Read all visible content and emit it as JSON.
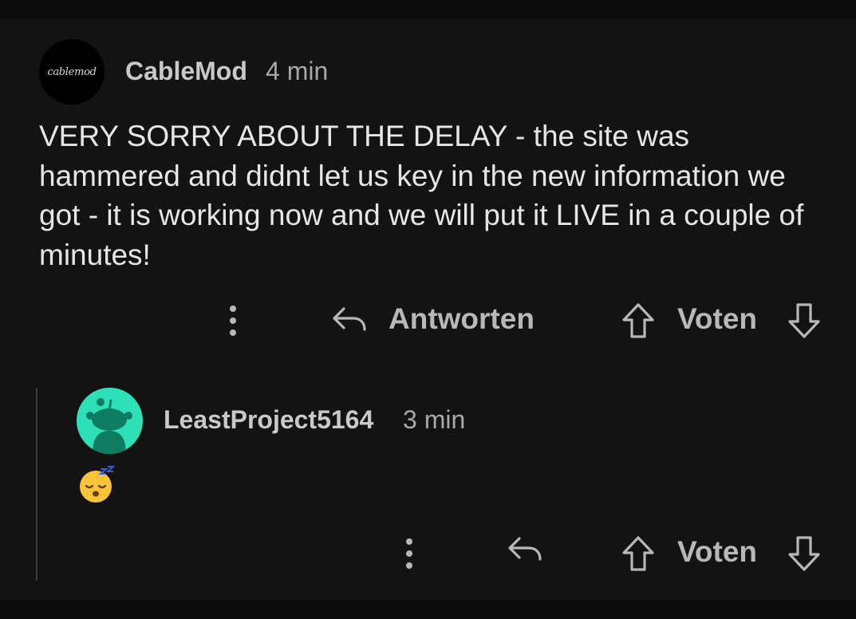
{
  "comment": {
    "avatar_logo_text": "cablemod",
    "author": "CableMod",
    "time": "4 min",
    "body": "VERY SORRY ABOUT THE DELAY - the site was hammered and didnt let us key in the new information we got - it is working now and we will put it LIVE in a couple of minutes!",
    "actions": {
      "more_icon": "vertical-ellipsis-icon",
      "reply_icon": "reply-arrow-icon",
      "reply_label": "Antworten",
      "upvote_icon": "arrow-up-icon",
      "vote_label": "Voten",
      "downvote_icon": "arrow-down-icon"
    }
  },
  "reply": {
    "avatar_icon": "snoo-avatar-icon",
    "author": "LeastProject5164",
    "time": "3 min",
    "body_emoji": "sleeping-face-emoji",
    "actions": {
      "more_icon": "vertical-ellipsis-icon",
      "reply_icon": "reply-arrow-icon",
      "upvote_icon": "arrow-up-icon",
      "vote_label": "Voten",
      "downvote_icon": "arrow-down-icon"
    }
  },
  "colors": {
    "background": "#131313",
    "frame": "#0b0b0b",
    "text_primary": "#e6e6e6",
    "text_secondary": "#b8b8b8",
    "avatar_accent": "#2ee0b8",
    "thread_line": "#3c3c3c"
  }
}
